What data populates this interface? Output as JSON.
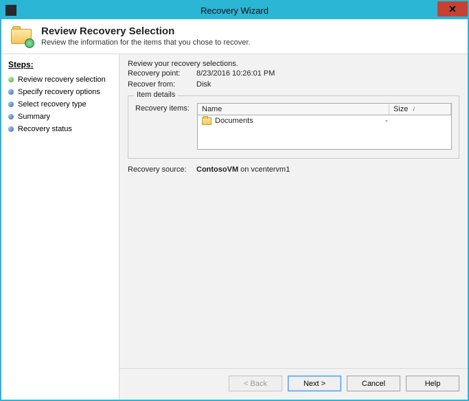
{
  "window": {
    "title": "Recovery Wizard",
    "close_glyph": "✕"
  },
  "header": {
    "title": "Review Recovery Selection",
    "subtitle": "Review the information for the items that you chose to recover."
  },
  "sidebar": {
    "title": "Steps:",
    "steps": [
      {
        "label": "Review recovery selection",
        "current": true
      },
      {
        "label": "Specify recovery options",
        "current": false
      },
      {
        "label": "Select recovery type",
        "current": false
      },
      {
        "label": "Summary",
        "current": false
      },
      {
        "label": "Recovery status",
        "current": false
      }
    ]
  },
  "content": {
    "intro": "Review your recovery selections.",
    "recovery_point_label": "Recovery point:",
    "recovery_point_value": "8/23/2016 10:26:01 PM",
    "recover_from_label": "Recover from:",
    "recover_from_value": "Disk",
    "item_details_legend": "Item details",
    "recovery_items_label": "Recovery items:",
    "table": {
      "columns": {
        "name": "Name",
        "size": "Size"
      },
      "sort_glyph": "/",
      "rows": [
        {
          "name": "Documents",
          "size": "-"
        }
      ]
    },
    "recovery_source_label": "Recovery source:",
    "recovery_source_bold": "ContosoVM",
    "recovery_source_rest": " on vcentervm1"
  },
  "buttons": {
    "back": "< Back",
    "next": "Next >",
    "cancel": "Cancel",
    "help": "Help"
  }
}
